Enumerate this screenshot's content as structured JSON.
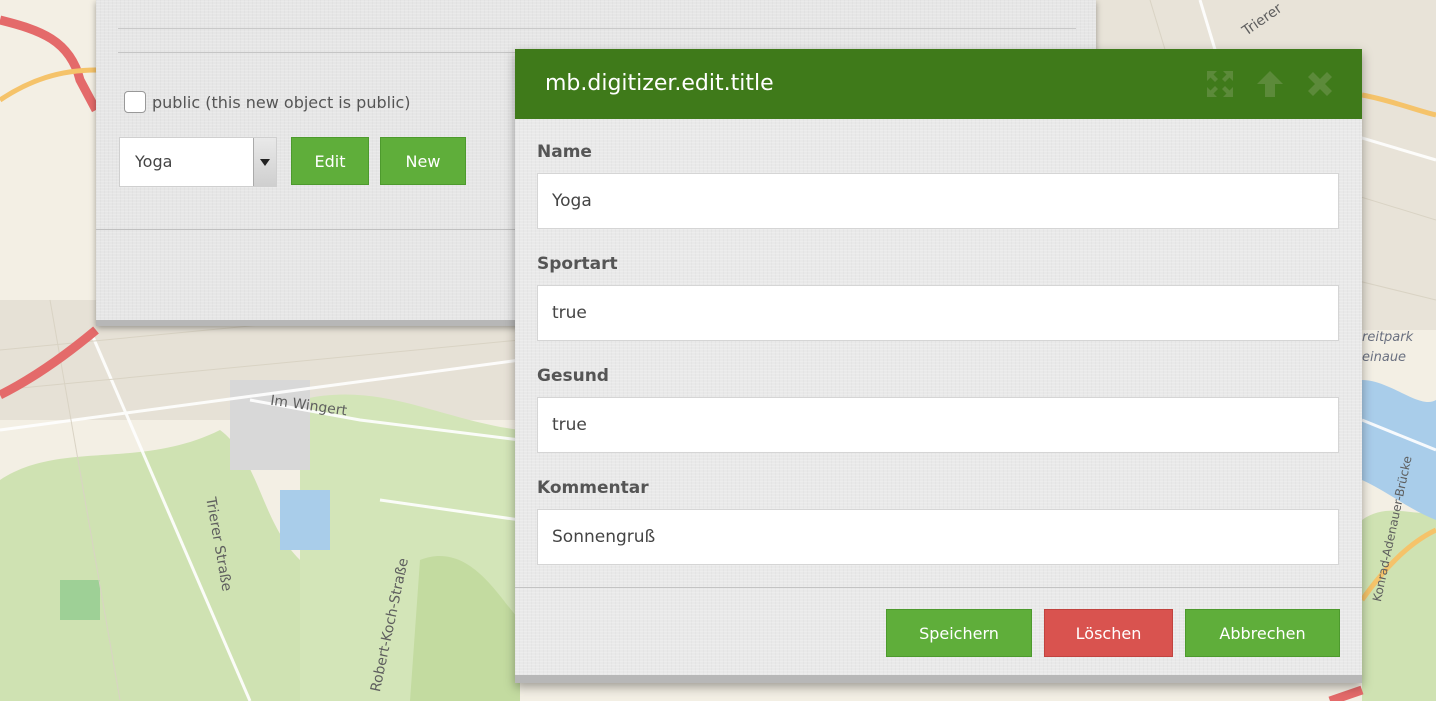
{
  "map": {
    "labels": [
      "Im Wingert",
      "Trierer Straße",
      "Robert-Koch-Straße",
      "Trierer",
      "reitpark",
      "einaue",
      "Konrad-Adenauer-Brücke"
    ]
  },
  "background_panel": {
    "public_checkbox_label": "public (this new object is public)",
    "public_checked": false,
    "select_value": "Yoga",
    "edit_label": "Edit",
    "new_label": "New"
  },
  "dialog": {
    "title": "mb.digitizer.edit.title",
    "icons": [
      "expand-icon",
      "arrow-up-icon",
      "close-icon"
    ],
    "fields": [
      {
        "label": "Name",
        "value": "Yoga"
      },
      {
        "label": "Sportart",
        "value": "true"
      },
      {
        "label": "Gesund",
        "value": "true"
      },
      {
        "label": "Kommentar",
        "value": "Sonnengruß"
      }
    ],
    "buttons": {
      "save_label": "Speichern",
      "delete_label": "Löschen",
      "cancel_label": "Abbrechen"
    }
  },
  "colors": {
    "header_green": "#3f7a1a",
    "button_green": "#5fae3a",
    "button_red": "#d9534f"
  }
}
